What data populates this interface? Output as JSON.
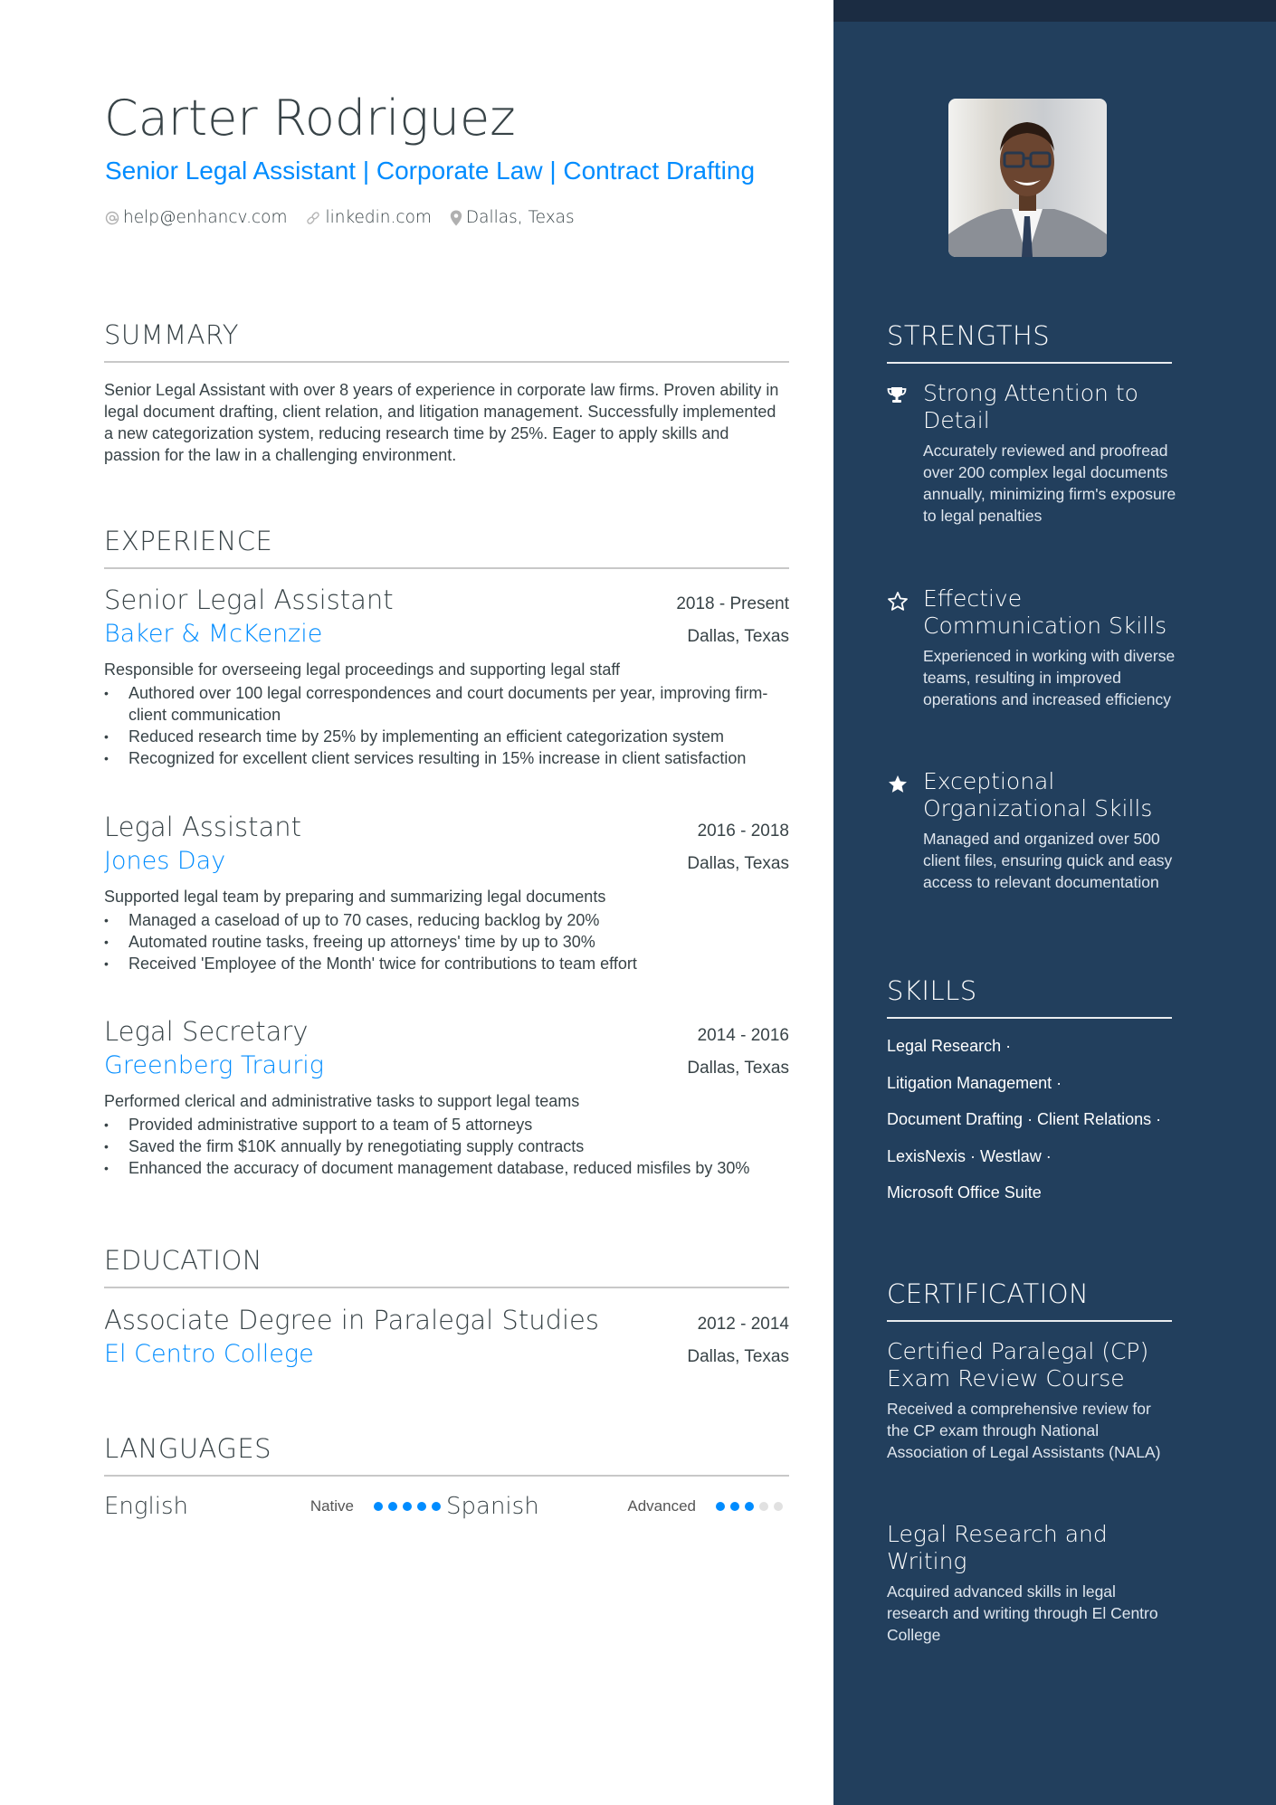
{
  "header": {
    "name": "Carter Rodriguez",
    "title": "Senior Legal Assistant | Corporate Law | Contract Drafting",
    "contacts": [
      {
        "icon": "at-icon",
        "text": "help@enhancv.com"
      },
      {
        "icon": "link-icon",
        "text": "linkedin.com"
      },
      {
        "icon": "location-pin-icon",
        "text": "Dallas, Texas"
      }
    ]
  },
  "summary": {
    "heading": "SUMMARY",
    "text": "Senior Legal Assistant with over 8 years of experience in corporate law firms. Proven ability in legal document drafting, client relation, and litigation management. Successfully implemented a new categorization system, reducing research time by 25%. Eager to apply skills and passion for the law in a challenging environment."
  },
  "experience": {
    "heading": "EXPERIENCE",
    "jobs": [
      {
        "title": "Senior Legal Assistant",
        "dates": "2018 - Present",
        "company": "Baker & McKenzie",
        "location": "Dallas, Texas",
        "description": "Responsible for overseeing legal proceedings and supporting legal staff",
        "bullets": [
          "Authored over 100 legal correspondences and court documents per year, improving firm-client communication",
          "Reduced research time by 25% by implementing an efficient categorization system",
          "Recognized for excellent client services resulting in 15% increase in client satisfaction"
        ]
      },
      {
        "title": "Legal Assistant",
        "dates": "2016 - 2018",
        "company": "Jones Day",
        "location": "Dallas, Texas",
        "description": "Supported legal team by preparing and summarizing legal documents",
        "bullets": [
          "Managed a caseload of up to 70 cases, reducing backlog by 20%",
          "Automated routine tasks, freeing up attorneys' time by up to 30%",
          "Received 'Employee of the Month' twice for contributions to team effort"
        ]
      },
      {
        "title": "Legal Secretary",
        "dates": "2014 - 2016",
        "company": "Greenberg Traurig",
        "location": "Dallas, Texas",
        "description": "Performed clerical and administrative tasks to support legal teams",
        "bullets": [
          "Provided administrative support to a team of 5 attorneys",
          "Saved the firm $10K annually by renegotiating supply contracts",
          "Enhanced the accuracy of document management database, reduced misfiles by 30%"
        ]
      }
    ]
  },
  "education": {
    "heading": "EDUCATION",
    "items": [
      {
        "degree": "Associate Degree in Paralegal Studies",
        "dates": "2012 - 2014",
        "school": "El Centro College",
        "location": "Dallas, Texas"
      }
    ]
  },
  "languages": {
    "heading": "LANGUAGES",
    "items": [
      {
        "name": "English",
        "level": "Native",
        "rating": 5,
        "max": 5
      },
      {
        "name": "Spanish",
        "level": "Advanced",
        "rating": 3,
        "max": 5
      }
    ]
  },
  "photo": {
    "alt": "Profile photo"
  },
  "strengths": {
    "heading": "STRENGTHS",
    "items": [
      {
        "icon": "trophy-icon",
        "title": "Strong Attention to Detail",
        "description": "Accurately reviewed and proofread over 200 complex legal documents annually, minimizing firm's exposure to legal penalties"
      },
      {
        "icon": "star-outline-icon",
        "title": "Effective Communication Skills",
        "description": "Experienced in working with diverse teams, resulting in improved operations and increased efficiency"
      },
      {
        "icon": "star-filled-icon",
        "title": "Exceptional Organizational Skills",
        "description": "Managed and organized over 500 client files, ensuring quick and easy access to relevant documentation"
      }
    ]
  },
  "skills": {
    "heading": "SKILLS",
    "lines": [
      "Legal Research ·",
      "Litigation Management ·",
      "Document Drafting · Client Relations ·",
      "LexisNexis · Westlaw ·",
      "Microsoft Office Suite"
    ]
  },
  "certification": {
    "heading": "CERTIFICATION",
    "items": [
      {
        "title": "Certified Paralegal (CP) Exam Review Course",
        "description": "Received a comprehensive review for the CP exam through National Association of Legal Assistants (NALA)"
      },
      {
        "title": "Legal Research and Writing",
        "description": "Acquired advanced skills in legal research and writing through El Centro College"
      }
    ]
  },
  "colors": {
    "accent": "#008cff",
    "sidebar": "#223f5d",
    "sidebar_topbar": "#1b2c42",
    "text": "#384347",
    "dot_off": "#e1e1e1"
  }
}
